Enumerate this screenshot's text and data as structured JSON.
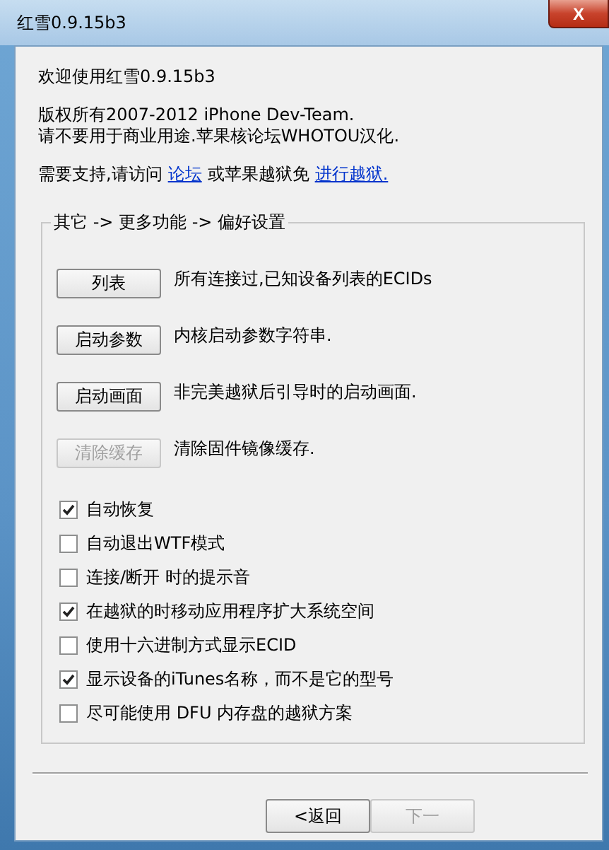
{
  "window": {
    "title": "红雪0.9.15b3",
    "close": "X"
  },
  "intro": {
    "welcome": "欢迎使用红雪0.9.15b3",
    "copyright": "版权所有2007-2012 iPhone Dev-Team.",
    "notice": "请不要用于商业用途.苹果核论坛WHOTOU汉化.",
    "support_prefix": "需要支持,请访问",
    "forum_link": "论坛",
    "support_middle": "或苹果越狱免",
    "jailbreak_link": "进行越狱."
  },
  "group": {
    "legend": "其它 -> 更多功能 -> 偏好设置",
    "actions": [
      {
        "button": "列表",
        "description": "所有连接过,已知设备列表的ECIDs",
        "disabled": false
      },
      {
        "button": "启动参数",
        "description": "内核启动参数字符串.",
        "disabled": false
      },
      {
        "button": "启动画面",
        "description": "非完美越狱后引导时的启动画面.",
        "disabled": false
      },
      {
        "button": "清除缓存",
        "description": "清除固件镜像缓存.",
        "disabled": true
      }
    ],
    "options": [
      {
        "label": "自动恢复",
        "checked": true
      },
      {
        "label": "自动退出WTF模式",
        "checked": false
      },
      {
        "label": "连接/断开 时的提示音",
        "checked": false
      },
      {
        "label": "在越狱的时移动应用程序扩大系统空间",
        "checked": true
      },
      {
        "label": "使用十六进制方式显示ECID",
        "checked": false
      },
      {
        "label": "显示设备的iTunes名称，而不是它的型号",
        "checked": true
      },
      {
        "label": "尽可能使用 DFU 内存盘的越狱方案",
        "checked": false
      }
    ]
  },
  "footer": {
    "buttons": [
      {
        "label": "<返回",
        "disabled": false
      },
      {
        "label": "下一",
        "disabled": true
      }
    ]
  }
}
